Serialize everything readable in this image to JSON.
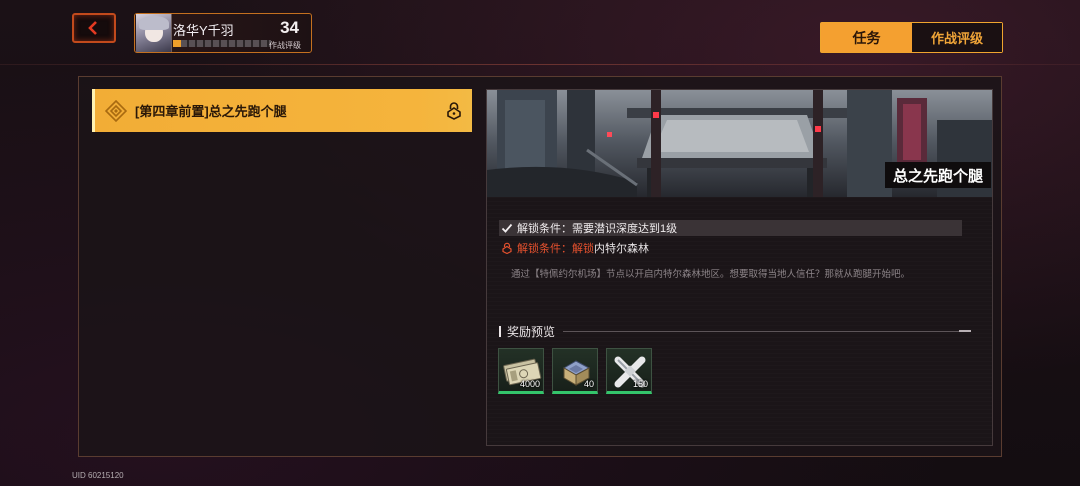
{
  "header": {
    "back_label": "back",
    "player": {
      "name": "洛华Y千羽",
      "level": "34",
      "rating_label": "作战评级",
      "exp_fraction": 0.08
    },
    "tabs": [
      {
        "label": "任务",
        "active": true
      },
      {
        "label": "作战评级",
        "active": false
      }
    ]
  },
  "quest_list": {
    "items": [
      {
        "title": "[第四章前置]总之先跑个腿",
        "locked": true
      }
    ]
  },
  "detail": {
    "banner_title": "总之先跑个腿",
    "conditions": [
      {
        "met": true,
        "label": "解锁条件：",
        "text": "需要潜识深度达到1级"
      },
      {
        "met": false,
        "label": "解锁条件：",
        "highlight": "解锁",
        "text": "内特尔森林"
      }
    ],
    "description": "通过【特佩约尔机场】节点以开启内特尔森林地区。想要取得当地人信任？那就从跑腿开始吧。",
    "rewards_title": "奖励预览",
    "rewards": [
      {
        "icon": "banknote-icon",
        "count": "4000"
      },
      {
        "icon": "supply-box-icon",
        "count": "40"
      },
      {
        "icon": "crossed-tools-icon",
        "count": "150"
      }
    ]
  },
  "footer": {
    "uid": "UID 60215120"
  },
  "colors": {
    "accent": "#f4a030",
    "alert": "#e5512e",
    "reward_border": "#34c46b"
  }
}
